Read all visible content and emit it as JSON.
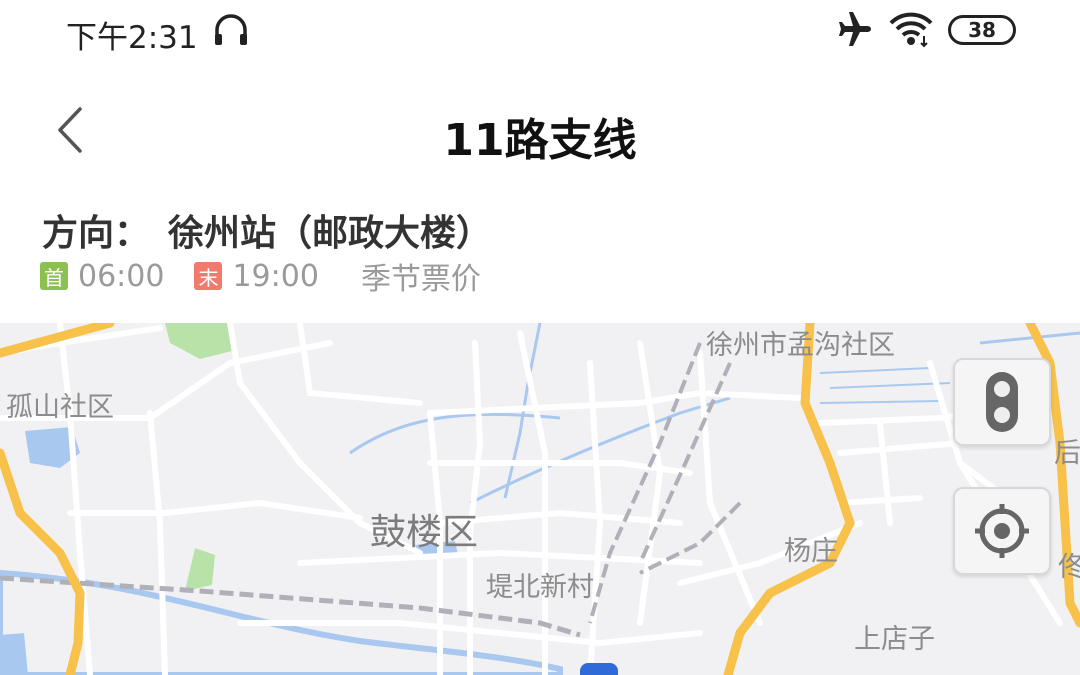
{
  "status_bar": {
    "time": "下午2:31",
    "battery": "38",
    "icons": [
      "headset-icon",
      "airplane-mode-icon",
      "wifi-icon",
      "battery-icon"
    ]
  },
  "header": {
    "title": "11路支线",
    "back_icon": "chevron-left-icon"
  },
  "route": {
    "direction_label": "方向：",
    "direction_value": "徐州站（邮政大楼）",
    "first_badge": "首",
    "first_time": "06:00",
    "last_badge": "末",
    "last_time": "19:00",
    "fare_link": "季节票价"
  },
  "map": {
    "labels": {
      "mengou": "徐州市孟沟社区",
      "gushan": "孤山社区",
      "gulou": "鼓楼区",
      "dibei": "堤北新村",
      "yangzhuang": "杨庄",
      "shangdianzi": "上店子",
      "edge_right1": "后",
      "edge_right2": "佟"
    },
    "buttons": [
      "traffic-light-icon",
      "locate-icon"
    ],
    "colors": {
      "background": "#f1f1f3",
      "road": "#ffffff",
      "highway": "#f7c14a",
      "water": "#a9c8f0",
      "green": "#b9e2a8",
      "rail": "#b0b0b8"
    }
  }
}
